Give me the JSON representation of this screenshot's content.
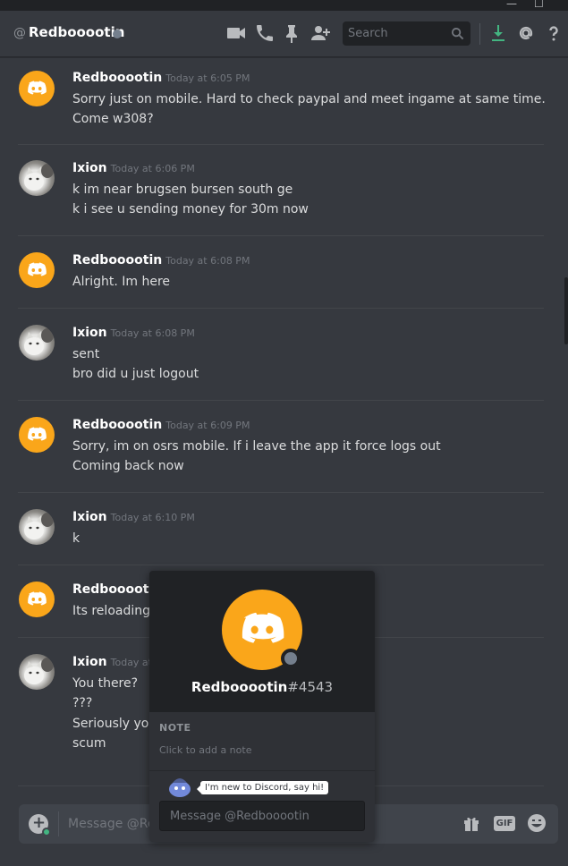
{
  "window": {
    "controls": [
      "—",
      "☐"
    ]
  },
  "header": {
    "prefix": "@",
    "username": "Redbooootin",
    "search_placeholder": "Search",
    "icons": [
      "video-call-icon",
      "voice-call-icon",
      "pin-icon",
      "add-friend-icon",
      "search-icon",
      "download-icon",
      "mention-icon",
      "help-icon"
    ]
  },
  "messages": [
    {
      "author": "Redbooootin",
      "timestamp": "Today at 6:05 PM",
      "avatar": "discord-logo",
      "lines": [
        "Sorry just on mobile. Hard to check paypal and meet ingame at same time.",
        "Come w308?"
      ]
    },
    {
      "author": "Ixion",
      "timestamp": "Today at 6:06 PM",
      "avatar": "cat-photo",
      "lines": [
        "k im near brugsen bursen south ge",
        "k i see u sending money for 30m now"
      ]
    },
    {
      "author": "Redbooootin",
      "timestamp": "Today at 6:08 PM",
      "avatar": "discord-logo",
      "lines": [
        "Alright. Im here"
      ]
    },
    {
      "author": "Ixion",
      "timestamp": "Today at 6:08 PM",
      "avatar": "cat-photo",
      "lines": [
        "sent",
        "bro did u just logout"
      ]
    },
    {
      "author": "Redbooootin",
      "timestamp": "Today at 6:09 PM",
      "avatar": "discord-logo",
      "lines": [
        "Sorry, im on osrs mobile. If i leave the app it force logs out",
        "Coming back now"
      ]
    },
    {
      "author": "Ixion",
      "timestamp": "Today at 6:10 PM",
      "avatar": "cat-photo",
      "lines": [
        "k"
      ]
    },
    {
      "author": "Redbooootin",
      "timestamp": "",
      "avatar": "discord-logo",
      "lines": [
        "Its reloading"
      ]
    },
    {
      "author": "Ixion",
      "timestamp": "Today at 6",
      "avatar": "cat-photo",
      "lines": [
        "You there?",
        "???",
        "Seriously you",
        "scum"
      ]
    }
  ],
  "composer": {
    "placeholder": "Message @Red",
    "icons": [
      "upload-icon",
      "gift-icon",
      "gif-icon",
      "emoji-icon"
    ],
    "gif_label": "GIF"
  },
  "profile_popout": {
    "username": "Redbooootin",
    "discriminator": "#4543",
    "note_title": "NOTE",
    "note_placeholder": "Click to add a note",
    "tooltip": "I'm new to Discord, say hi!",
    "dm_placeholder": "Message @Redbooootin"
  },
  "colors": {
    "brand_orange": "#faa61a",
    "background": "#36393f",
    "download_green": "#43b581"
  }
}
